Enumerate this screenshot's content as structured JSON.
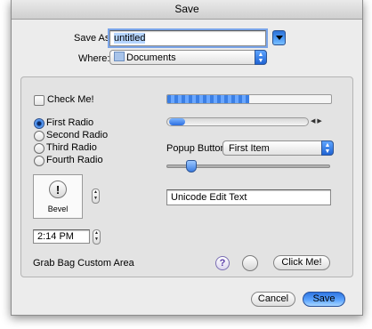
{
  "window": {
    "title": "Save"
  },
  "save_as": {
    "label": "Save As:",
    "value": "untitled"
  },
  "where": {
    "label": "Where:",
    "value": "Documents"
  },
  "check_me": {
    "label": "Check Me!"
  },
  "radios": [
    {
      "label": "First Radio",
      "selected": true
    },
    {
      "label": "Second Radio",
      "selected": false
    },
    {
      "label": "Third Radio",
      "selected": false
    },
    {
      "label": "Fourth Radio",
      "selected": false
    }
  ],
  "bevel": {
    "label": "Bevel",
    "icon_glyph": "!"
  },
  "time": {
    "value": "2:14 PM"
  },
  "popup_button": {
    "label": "Popup Button",
    "value": "First Item"
  },
  "unicode_field": {
    "value": "Unicode Edit Text"
  },
  "grab_bag": {
    "label": "Grab Bag Custom Area",
    "help_glyph": "?",
    "click_me": "Click Me!"
  },
  "buttons": {
    "cancel": "Cancel",
    "save": "Save"
  },
  "progress": {
    "fraction": 0.5
  },
  "slider": {
    "fraction": 0.13
  },
  "colors": {
    "accent": "#3c7de2",
    "window_bg": "#ececec",
    "group_bg": "#e3e3e3"
  }
}
